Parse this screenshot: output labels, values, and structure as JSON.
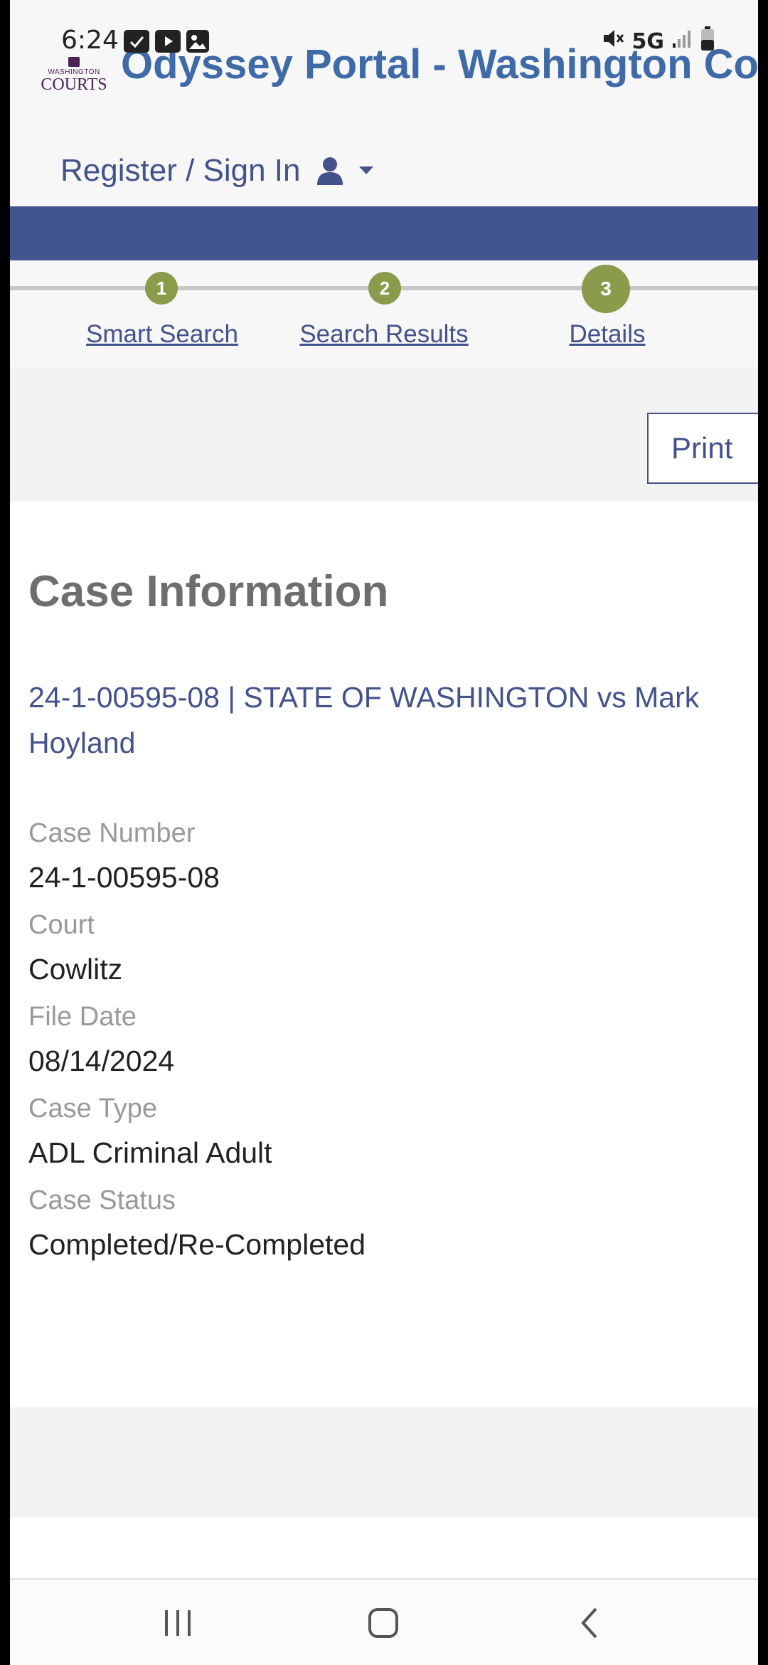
{
  "status_bar": {
    "time": "6:24",
    "network": "5G",
    "left_icons": [
      "calendar-check-icon",
      "youtube-icon",
      "gallery-icon"
    ],
    "right_icons": [
      "mute-icon",
      "signal-icon",
      "battery-icon"
    ]
  },
  "header": {
    "logo_small": "WASHINGTON",
    "logo_big": "COURTS",
    "title": "Odyssey Portal - Washington Courts",
    "signin_label": "Register / Sign In",
    "signin_icons": [
      "user-icon",
      "caret-down-icon"
    ]
  },
  "colors": {
    "brand_blue": "#42558f",
    "link_blue": "#44528c",
    "step_green": "#8b9b4c"
  },
  "steps": [
    {
      "number": "1",
      "label": "Smart Search"
    },
    {
      "number": "2",
      "label": "Search Results"
    },
    {
      "number": "3",
      "label": "Details"
    }
  ],
  "toolbar": {
    "print_label": "Print"
  },
  "case": {
    "heading": "Case Information",
    "title_link": "24-1-00595-08 | STATE OF WASHINGTON vs Mark Hoyland",
    "fields": [
      {
        "label": "Case Number",
        "value": "24-1-00595-08"
      },
      {
        "label": "Court",
        "value": "Cowlitz"
      },
      {
        "label": "File Date",
        "value": "08/14/2024"
      },
      {
        "label": "Case Type",
        "value": "ADL Criminal Adult"
      },
      {
        "label": "Case Status",
        "value": "Completed/Re-Completed"
      }
    ]
  },
  "nav": {
    "buttons": [
      "recent-apps-icon",
      "home-icon",
      "back-icon"
    ]
  }
}
